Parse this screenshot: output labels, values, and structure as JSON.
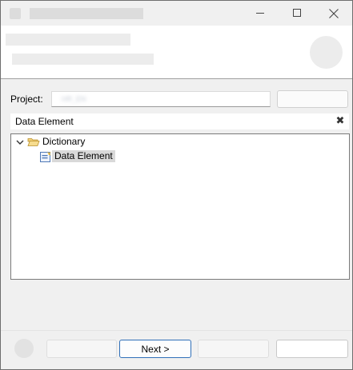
{
  "titlebar": {
    "minimize_icon": "minimize-icon",
    "maximize_icon": "maximize-icon",
    "close_icon": "close-icon"
  },
  "form": {
    "project_label": "Project:",
    "project_value": "HR_EN",
    "filter_value": "Data Element",
    "clear_icon": "✖"
  },
  "tree": {
    "items": [
      {
        "label": "Dictionary",
        "icon": "folder-open-icon",
        "expanded": true
      },
      {
        "label": "Data Element",
        "icon": "data-element-icon",
        "selected": true
      }
    ]
  },
  "footer": {
    "next_label": "Next >"
  },
  "colors": {
    "window_bg": "#f0f0f0",
    "selection": "#d9d9d9",
    "default_button_border": "#2f6fb8",
    "folder": "#e8c15a"
  }
}
